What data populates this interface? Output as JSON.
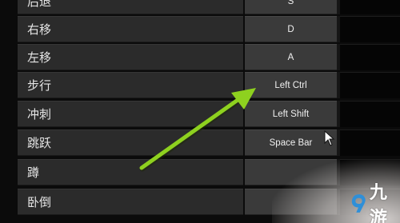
{
  "keybindings": [
    {
      "action": "后退",
      "primary": "S",
      "secondary": ""
    },
    {
      "action": "右移",
      "primary": "D",
      "secondary": ""
    },
    {
      "action": "左移",
      "primary": "A",
      "secondary": ""
    },
    {
      "action": "步行",
      "primary": "Left Ctrl",
      "secondary": ""
    },
    {
      "action": "冲刺",
      "primary": "Left Shift",
      "secondary": ""
    },
    {
      "action": "跳跃",
      "primary": "Space Bar",
      "secondary": ""
    },
    {
      "action": "蹲",
      "primary": "",
      "secondary": ""
    },
    {
      "action": "卧倒",
      "primary": "",
      "secondary": ""
    }
  ],
  "watermark": {
    "text": "九游"
  },
  "colors": {
    "arrow": "#8ed11f",
    "watermark_logo": "#2f8fd8"
  }
}
